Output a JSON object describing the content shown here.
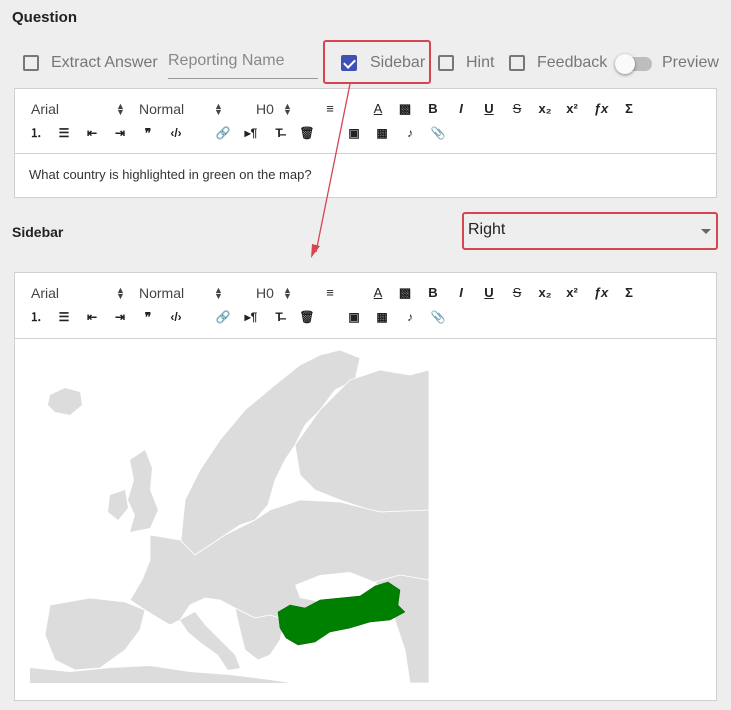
{
  "question": {
    "title": "Question",
    "options": {
      "extract_answer": {
        "label": "Extract Answer",
        "checked": false
      },
      "reporting_name_placeholder": "Reporting Name",
      "sidebar": {
        "label": "Sidebar",
        "checked": true
      },
      "hint": {
        "label": "Hint",
        "checked": false
      },
      "feedback": {
        "label": "Feedback",
        "checked": false
      },
      "preview": {
        "label": "Preview",
        "on": false
      }
    },
    "text": "What country is highlighted in green on the map?"
  },
  "toolbar": {
    "font": "Arial",
    "size": "Normal",
    "heading": "H0",
    "icons": [
      "align-icon",
      "text-color-icon",
      "background-color-icon",
      "bold-icon",
      "italic-icon",
      "underline-icon",
      "strike-icon",
      "subscript-icon",
      "superscript-icon",
      "formula-icon",
      "sigma-icon",
      "ordered-list-icon",
      "bullet-list-icon",
      "outdent-icon",
      "indent-icon",
      "blockquote-icon",
      "code-icon",
      "link-icon",
      "paragraph-icon",
      "clear-format-icon",
      "trash-icon",
      "image-icon",
      "video-icon",
      "audio-icon",
      "attachment-icon"
    ]
  },
  "sidebar": {
    "title": "Sidebar",
    "position": "Right",
    "map": {
      "highlighted_country_color": "#008000",
      "land_color": "#dcdcdc"
    }
  },
  "colors": {
    "accent": "#3f51b5",
    "highlight_border": "#d64550",
    "arrow": "#d64550"
  }
}
